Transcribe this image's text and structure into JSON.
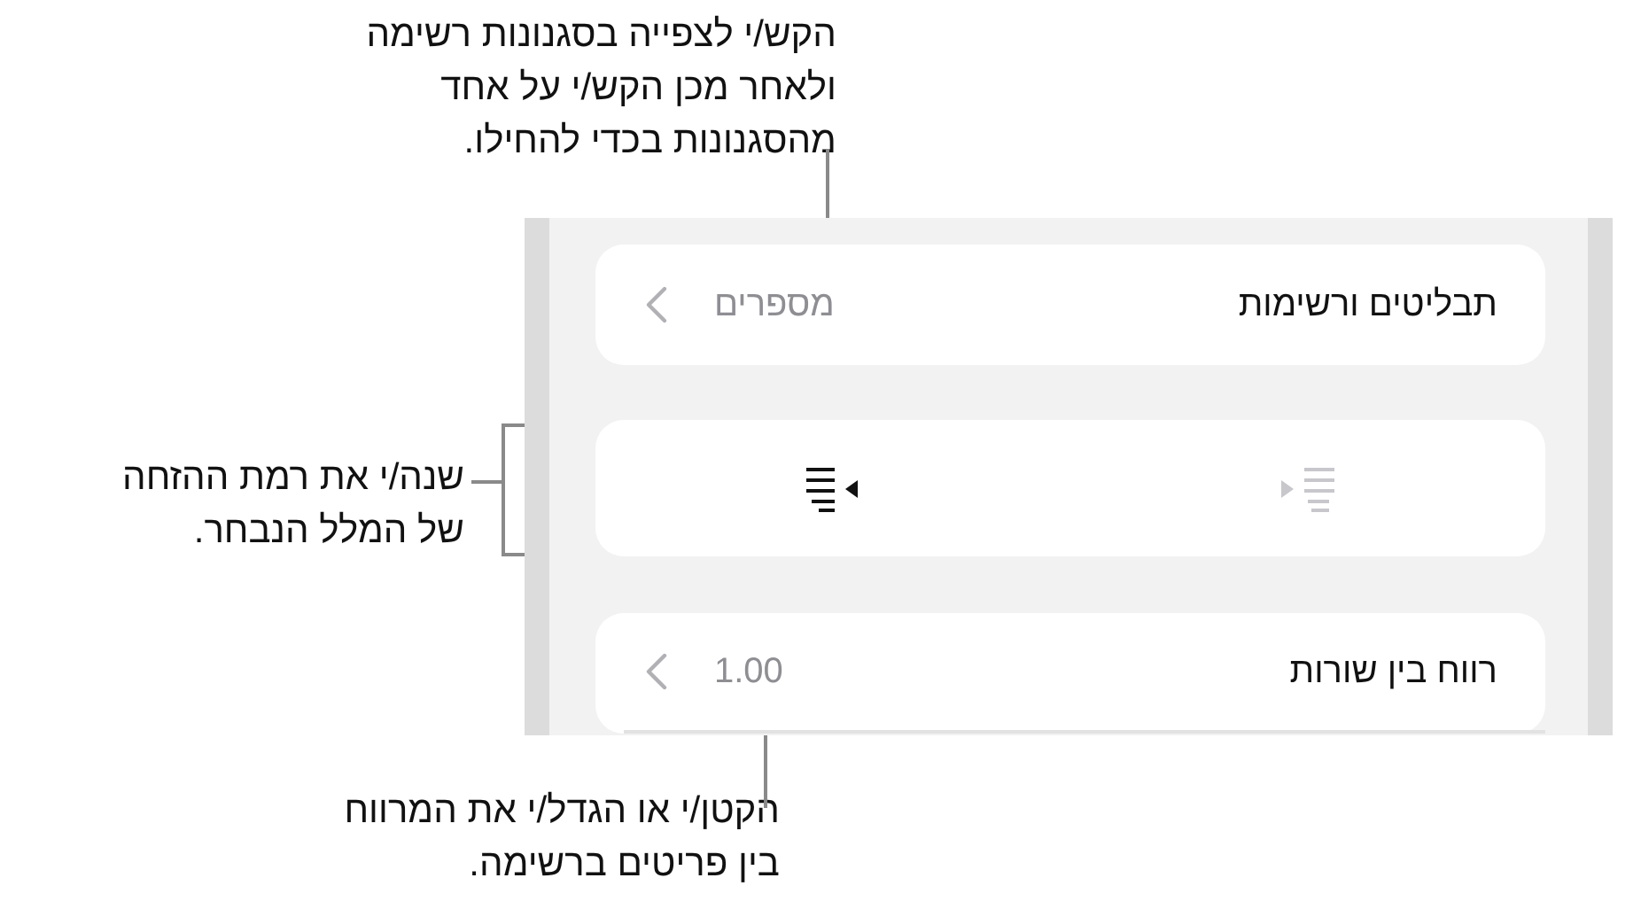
{
  "callouts": [
    {
      "kind": "top",
      "lines": [
        "הקש/י לצפייה בסגנונות רשימה",
        "ולאחר מכן הקש/י על אחד",
        "מהסגנונות בכדי להחילו."
      ]
    },
    {
      "kind": "side",
      "lines": [
        "שנה/י את רמת ההזחה",
        "של המלל הנבחר."
      ]
    },
    {
      "kind": "bottom",
      "lines": [
        "הקטן/י או הגדל/י את המרווח",
        "בין פריטים ברשימה."
      ]
    }
  ],
  "panel": {
    "rows": [
      {
        "kind": "disclosure",
        "label": "תבליטים ורשימות",
        "value": "מספרים"
      },
      {
        "kind": "indent",
        "buttons": [
          {
            "kind": "decrease",
            "disabled": true
          },
          {
            "kind": "increase",
            "disabled": false
          }
        ]
      },
      {
        "kind": "disclosure",
        "label": "רווח בין שורות",
        "value": "1.00",
        "divider": true
      }
    ]
  }
}
